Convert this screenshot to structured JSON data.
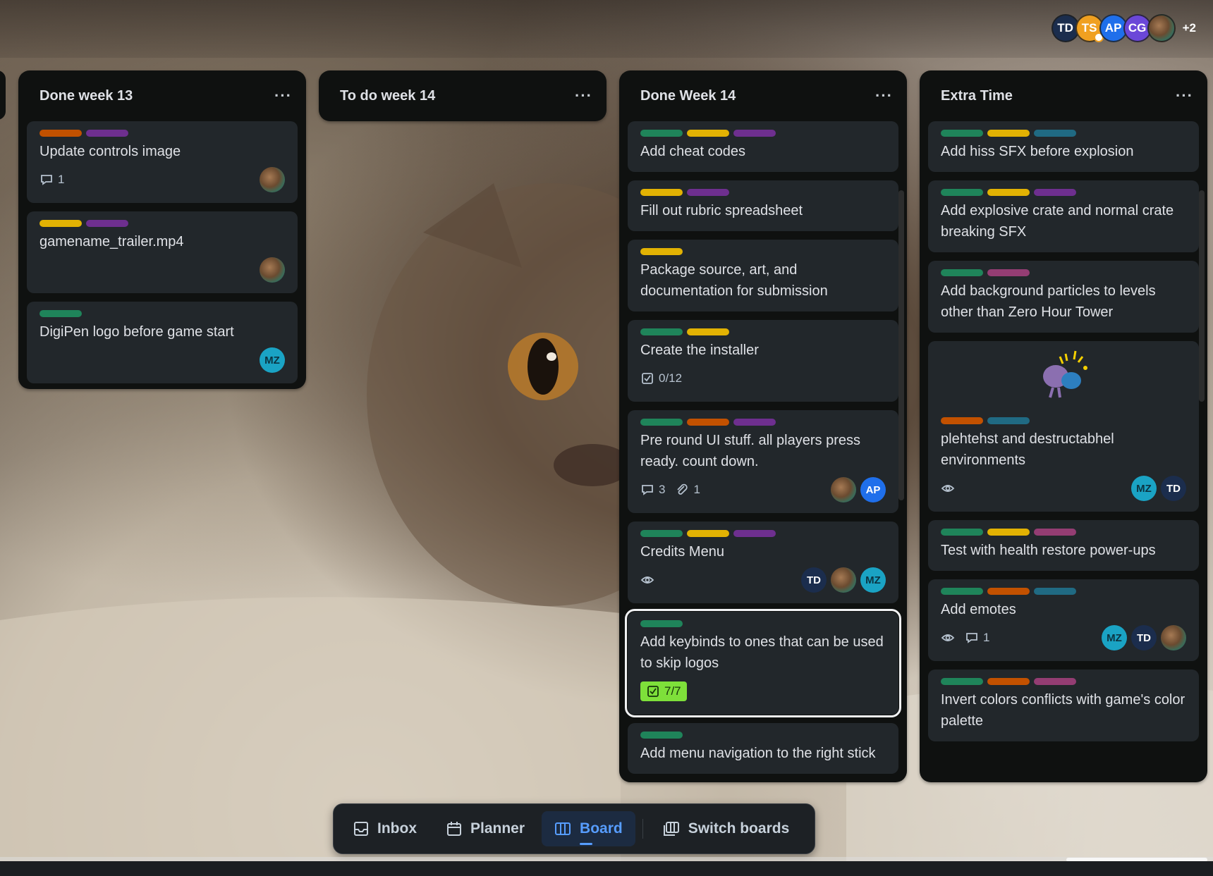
{
  "header": {
    "members": [
      {
        "initials": "TD",
        "color": "#1b2d4d"
      },
      {
        "initials": "TS",
        "color": "#f0a020"
      },
      {
        "initials": "AP",
        "color": "#1f6feb"
      },
      {
        "initials": "CG",
        "color": "#6b47d8"
      },
      {
        "initials": "",
        "color": "image"
      }
    ],
    "more": "+2"
  },
  "lists": [
    {
      "title": "Done week 13",
      "menu": "···",
      "cards": [
        {
          "labels": [
            "#c25100",
            "#6e2f8f"
          ],
          "title": "Update controls image",
          "comments": "1",
          "members": [
            "img"
          ]
        },
        {
          "labels": [
            "#e2b203",
            "#6e2f8f"
          ],
          "title": "gamename_trailer.mp4",
          "members": [
            "img"
          ]
        },
        {
          "labels": [
            "#1f845a"
          ],
          "title": "DigiPen logo before game start",
          "members": [
            "MZ"
          ]
        }
      ]
    },
    {
      "title": "To do week 14",
      "menu": "···",
      "cards": []
    },
    {
      "title": "Done Week 14",
      "menu": "···",
      "cards": [
        {
          "labels": [
            "#1f845a",
            "#e2b203",
            "#6e2f8f"
          ],
          "title": "Add cheat codes"
        },
        {
          "labels": [
            "#e2b203",
            "#6e2f8f"
          ],
          "title": "Fill out rubric spreadsheet"
        },
        {
          "labels": [
            "#e2b203"
          ],
          "title": "Package source, art, and documentation for submission"
        },
        {
          "labels": [
            "#1f845a",
            "#e2b203"
          ],
          "title": "Create the installer",
          "checklist": "0/12"
        },
        {
          "labels": [
            "#1f845a",
            "#c25100",
            "#6e2f8f"
          ],
          "title": "Pre round UI stuff. all players press ready. count down.",
          "comments": "3",
          "attachments": "1",
          "members": [
            "img",
            "AP"
          ]
        },
        {
          "labels": [
            "#1f845a",
            "#e2b203",
            "#6e2f8f"
          ],
          "title": "Credits Menu",
          "watch": true,
          "members": [
            "TD",
            "img",
            "MZ"
          ]
        },
        {
          "labels": [
            "#1f845a"
          ],
          "title": "Add keybinds to ones that can be used to skip logos",
          "checklist_done": "7/7"
        },
        {
          "labels": [
            "#1f845a"
          ],
          "title": "Add menu navigation to the right stick"
        }
      ]
    },
    {
      "title": "Extra Time",
      "menu": "···",
      "cards": [
        {
          "labels": [
            "#1f845a",
            "#e2b203",
            "#206a83"
          ],
          "title": "Add hiss SFX before explosion"
        },
        {
          "labels": [
            "#1f845a",
            "#e2b203",
            "#6e2f8f"
          ],
          "title": "Add explosive crate and normal crate breaking SFX"
        },
        {
          "labels": [
            "#1f845a",
            "#943d73"
          ],
          "title": "Add background particles to levels other than Zero Hour Tower"
        },
        {
          "labels": [
            "#c25100",
            "#206a83"
          ],
          "title": "plehtehst and destructabhel environments",
          "watch": true,
          "members": [
            "MZ",
            "TD"
          ]
        },
        {
          "labels": [
            "#1f845a",
            "#e2b203",
            "#943d73"
          ],
          "title": "Test with health restore power-ups"
        },
        {
          "labels": [
            "#1f845a",
            "#c25100",
            "#206a83"
          ],
          "title": "Add emotes",
          "watch": true,
          "comments": "1",
          "members": [
            "MZ",
            "TD",
            "img"
          ]
        },
        {
          "labels": [
            "#1f845a",
            "#c25100",
            "#943d73"
          ],
          "title": "Invert colors conflicts with game's color palette"
        }
      ]
    }
  ],
  "nav": {
    "inbox": "Inbox",
    "planner": "Planner",
    "board": "Board",
    "switch": "Switch boards"
  }
}
